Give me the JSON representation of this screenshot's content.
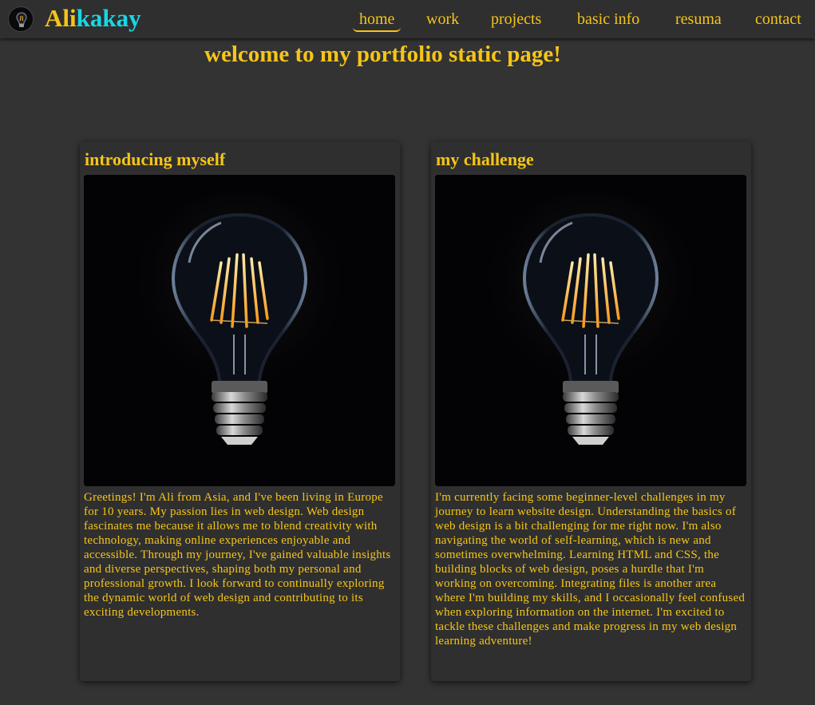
{
  "brand": {
    "part1": "Ali",
    "part2": "kakay",
    "accent_yellow": "#f5c518",
    "accent_cyan": "#19d6e3"
  },
  "logo": {
    "icon": "lightbulb-icon"
  },
  "nav": {
    "items": [
      {
        "label": "home",
        "active": true
      },
      {
        "label": "work"
      },
      {
        "label": "projects"
      },
      {
        "label": "basic info"
      },
      {
        "label": "resuma"
      },
      {
        "label": "contact"
      }
    ]
  },
  "hero": {
    "title": "welcome to my portfolio static page!"
  },
  "cards": [
    {
      "title": "introducing myself",
      "image": "lightbulb-photo",
      "text": "Greetings! I'm Ali from Asia, and I've been living in Europe for 10 years. My passion lies in web design. Web design fascinates me because it allows me to blend creativity with technology, making online experiences enjoyable and accessible. Through my journey, I've gained valuable insights and diverse perspectives, shaping both my personal and professional growth. I look forward to continually exploring the dynamic world of web design and contributing to its exciting developments."
    },
    {
      "title": "my challenge",
      "image": "lightbulb-photo",
      "text": "I'm currently facing some beginner-level challenges in my journey to learn website design. Understanding the basics of web design is a bit challenging for me right now. I'm also navigating the world of self-learning, which is new and sometimes overwhelming. Learning HTML and CSS, the building blocks of web design, poses a hurdle that I'm working on overcoming. Integrating files is another area where I'm building my skills, and I occasionally feel confused when exploring information on the internet. I'm excited to tackle these challenges and make progress in my web design learning adventure!"
    }
  ]
}
